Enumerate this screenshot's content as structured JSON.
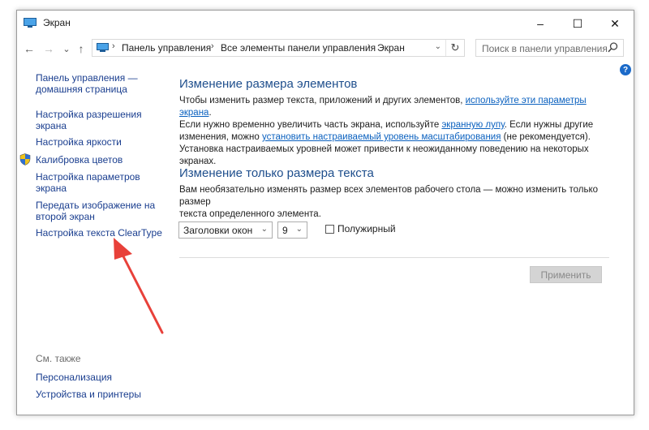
{
  "window": {
    "title": "Экран",
    "minimize": "–",
    "maximize": "☐",
    "close": "✕"
  },
  "nav": {
    "back": "←",
    "forward": "→",
    "recent": "⌄",
    "up": "↑"
  },
  "address": {
    "crumbs": [
      "Панель управления",
      "Все элементы панели управления",
      "Экран"
    ],
    "separator": "›",
    "dropdown": "⌄",
    "refresh": "↻"
  },
  "search": {
    "placeholder": "Поиск в панели управления"
  },
  "help": {
    "label": "?"
  },
  "sidebar": {
    "links": [
      {
        "label": "Панель управления —",
        "label2": "домашняя страница"
      },
      {
        "label": "Настройка разрешения",
        "label2": "экрана"
      },
      {
        "label": "Настройка яркости"
      },
      {
        "label": "Калибровка цветов"
      },
      {
        "label": "Настройка параметров",
        "label2": "экрана"
      },
      {
        "label": "Передать изображение на",
        "label2": "второй экран"
      },
      {
        "label": "Настройка текста ClearType"
      }
    ],
    "see_also": "См. также",
    "see_also_links": [
      "Персонализация",
      "Устройства и принтеры"
    ]
  },
  "main": {
    "section1": {
      "heading": "Изменение размера элементов",
      "l1_pre": "Чтобы изменить размер текста, приложений и других элементов, ",
      "l1_link": "используйте эти параметры экрана",
      "l1_post": ".",
      "l2_pre": "Если нужно временно увеличить часть экрана, используйте ",
      "l2_link": "экранную лупу",
      "l2_post": ". Если нужны другие",
      "l3_pre": "изменения, можно ",
      "l3_link": "установить настраиваемый уровень масштабирования",
      "l3_post": " (не рекомендуется).",
      "l4": "Установка настраиваемых уровней может привести к неожиданному поведению на некоторых экранах."
    },
    "section2": {
      "heading": "Изменение только размера текста",
      "l1": "Вам необязательно изменять размер всех элементов рабочего стола — можно изменить только размер",
      "l2": "текста определенного элемента."
    },
    "element_select": {
      "value": "Заголовки окон",
      "arrow": "⌄"
    },
    "size_select": {
      "value": "9",
      "arrow": "⌄"
    },
    "bold_checkbox": {
      "label": "Полужирный",
      "checked": false
    },
    "apply_button": "Применить"
  },
  "colors": {
    "link": "#1a3e8f",
    "heading": "#1e4e8c",
    "annotation_arrow": "#e8413a"
  }
}
